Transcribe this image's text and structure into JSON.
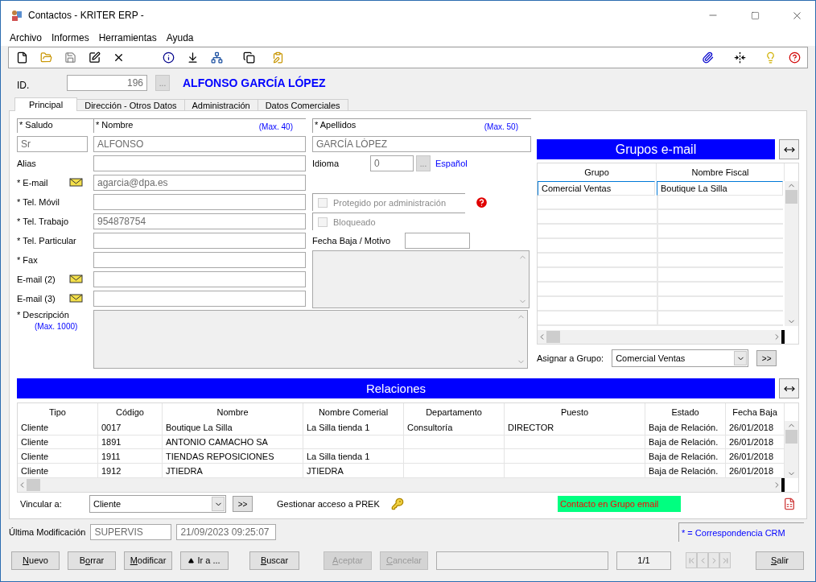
{
  "window": {
    "title": "Contactos - KRITER ERP -"
  },
  "menu": [
    "Archivo",
    "Informes",
    "Herramientas",
    "Ayuda"
  ],
  "header": {
    "id_label": "ID.",
    "id_value": "196",
    "ellipsis": "...",
    "contact_name": "ALFONSO GARCÍA LÓPEZ"
  },
  "tabs": [
    {
      "label": "Principal",
      "selected": true
    },
    {
      "label": "Dirección - Otros Datos",
      "selected": false
    },
    {
      "label": "Administración",
      "selected": false
    },
    {
      "label": "Datos Comerciales",
      "selected": false
    }
  ],
  "form": {
    "salutation": {
      "label": "* Saludo",
      "value": "Sr"
    },
    "first_name": {
      "label": "* Nombre",
      "hint": "(Max. 40)",
      "value": "ALFONSO"
    },
    "last_name": {
      "label": "* Apellidos",
      "hint": "(Max. 50)",
      "value": "GARCÍA LÓPEZ"
    },
    "fields": [
      {
        "label": "Alias",
        "kind": "text"
      },
      {
        "label": "* E-mail",
        "kind": "email",
        "value": "agarcia@dpa.es"
      },
      {
        "label": "* Tel. Móvil",
        "kind": "text"
      },
      {
        "label": "* Tel. Trabajo",
        "kind": "text",
        "value": "954878754"
      },
      {
        "label": "* Tel. Particular",
        "kind": "text"
      },
      {
        "label": "* Fax",
        "kind": "text"
      },
      {
        "label": "E-mail (2)",
        "kind": "email"
      },
      {
        "label": "E-mail (3)",
        "kind": "email"
      }
    ],
    "language": {
      "label": "Idioma",
      "code": "0",
      "ellipsis": "...",
      "name": "Español"
    },
    "protected": {
      "label": "Protegido por administración",
      "checked": false,
      "disabled": true
    },
    "blocked": {
      "label": "Bloqueado",
      "checked": false,
      "disabled": true
    },
    "leave_date": {
      "label": "Fecha Baja / Motivo"
    },
    "description": {
      "label": "* Descripción",
      "hint": "(Max. 1000)"
    }
  },
  "email_groups": {
    "title": "Grupos e-mail",
    "columns": [
      "Grupo",
      "Nombre Fiscal"
    ],
    "rows": [
      {
        "cells": [
          "Comercial Ventas",
          "Boutique La Silla"
        ],
        "selected": true
      }
    ],
    "assign_label": "Asignar a Grupo:",
    "assign_value": "Comercial Ventas",
    "assign_button": ">>"
  },
  "relations": {
    "title": "Relaciones",
    "columns": [
      "Tipo",
      "Código",
      "Nombre",
      "Nombre Comerial",
      "Departamento",
      "Puesto",
      "Estado",
      "Fecha Baja"
    ],
    "rows": [
      [
        "Cliente",
        "0017",
        "Boutique La Silla",
        "La Silla tienda 1",
        "Consultoría",
        "DIRECTOR",
        "Baja de Relación.",
        "26/01/2018"
      ],
      [
        "Cliente",
        "1891",
        "ANTONIO CAMACHO SA",
        "",
        "",
        "",
        "Baja de Relación.",
        "26/01/2018"
      ],
      [
        "Cliente",
        "1911",
        "TIENDAS REPOSICIONES",
        "La Silla tienda 1",
        "",
        "",
        "Baja de Relación.",
        "26/01/2018"
      ],
      [
        "Cliente",
        "1912",
        "JTIEDRA",
        "JTIEDRA",
        "",
        "",
        "Baja de Relación.",
        "26/01/2018"
      ]
    ],
    "link_label": "Vincular a:",
    "link_value": "Cliente",
    "link_button": ">>",
    "prek_label": "Gestionar acceso a PREK",
    "status": "Contacto en Grupo email"
  },
  "footer": {
    "modified_label": "Última Modificación",
    "modified_by": "SUPERVIS",
    "modified_at": "21/09/2023 09:25:07",
    "legend": "* = Correspondencia CRM"
  },
  "buttons": [
    {
      "key": "N",
      "after": "uevo",
      "disabled": false,
      "kind": "plain"
    },
    {
      "before": "B",
      "key": "o",
      "after": "rrar",
      "disabled": false,
      "kind": "plain"
    },
    {
      "key": "M",
      "after": "odificar",
      "disabled": false,
      "kind": "plain"
    },
    {
      "before": "Ir a ...",
      "disabled": false,
      "kind": "goto"
    },
    {
      "key": "B",
      "after": "uscar",
      "disabled": false,
      "kind": "plain"
    },
    {
      "key": "A",
      "after": "ceptar",
      "disabled": true,
      "kind": "plain"
    },
    {
      "key": "C",
      "after": "ancelar",
      "disabled": true,
      "kind": "plain"
    }
  ],
  "record_counter": "1/1",
  "exit_button": {
    "key": "S",
    "after": "alir",
    "disabled": false
  }
}
